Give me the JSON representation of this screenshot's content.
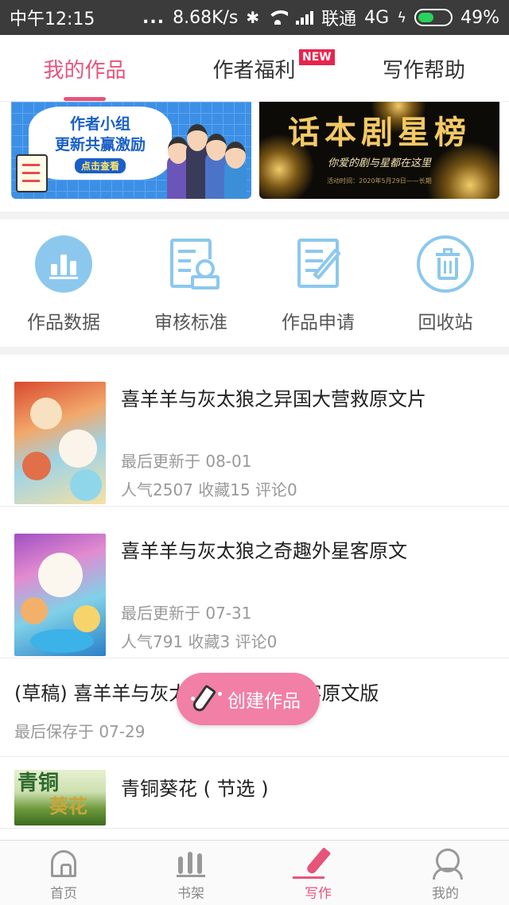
{
  "status_bar": {
    "time": "中午12:15",
    "dots": "...",
    "network_speed": "8.68K/s",
    "carrier": "联通",
    "network_type": "4G",
    "battery": "49%",
    "battery_level": 0.49,
    "icons": [
      "bluetooth-icon",
      "wifi-icon",
      "signal-icon",
      "charging-icon",
      "battery-icon"
    ]
  },
  "tabs": [
    {
      "label": "我的作品",
      "active": true
    },
    {
      "label": "作者福利",
      "badge": "NEW"
    },
    {
      "label": "写作帮助"
    }
  ],
  "banners": [
    {
      "line1": "作者小组",
      "line2": "更新共赢激励",
      "cta": "点击查看"
    },
    {
      "title": "话本剧星榜",
      "subtitle": "你爱的剧与星都在这里",
      "small": "活动时间：2020年5月29日——长期"
    }
  ],
  "quick_actions": [
    {
      "label": "作品数据",
      "icon": "bar-chart-icon"
    },
    {
      "label": "审核标准",
      "icon": "review-standard-icon"
    },
    {
      "label": "作品申请",
      "icon": "edit-document-icon"
    },
    {
      "label": "回收站",
      "icon": "trash-icon"
    }
  ],
  "works": [
    {
      "title": "喜羊羊与灰太狼之异国大营救原文片",
      "updated": "最后更新于 08-01",
      "stats": "人气2507  收藏15  评论0"
    },
    {
      "title": "喜羊羊与灰太狼之奇趣外星客原文",
      "updated": "最后更新于 07-31",
      "stats": "人气791  收藏3  评论0"
    },
    {
      "title": "(草稿) 喜羊羊与灰太狼之奇趣外星客原文版",
      "saved": "最后保存于 07-29"
    },
    {
      "title": "青铜葵花 ( 节选 )",
      "cover_text_1": "青铜",
      "cover_text_2": "葵花"
    }
  ],
  "fab": {
    "label": "创建作品"
  },
  "bottom_nav": [
    {
      "label": "首页",
      "icon": "home-icon"
    },
    {
      "label": "书架",
      "icon": "bookshelf-icon"
    },
    {
      "label": "写作",
      "icon": "write-icon",
      "active": true
    },
    {
      "label": "我的",
      "icon": "profile-icon"
    }
  ],
  "colors": {
    "accent": "#e6547a",
    "icon_blue": "#8cc8ee",
    "fab_pink": "#f27fa5",
    "status_bar": "#3b3b3b",
    "new_badge": "#e8244c"
  }
}
